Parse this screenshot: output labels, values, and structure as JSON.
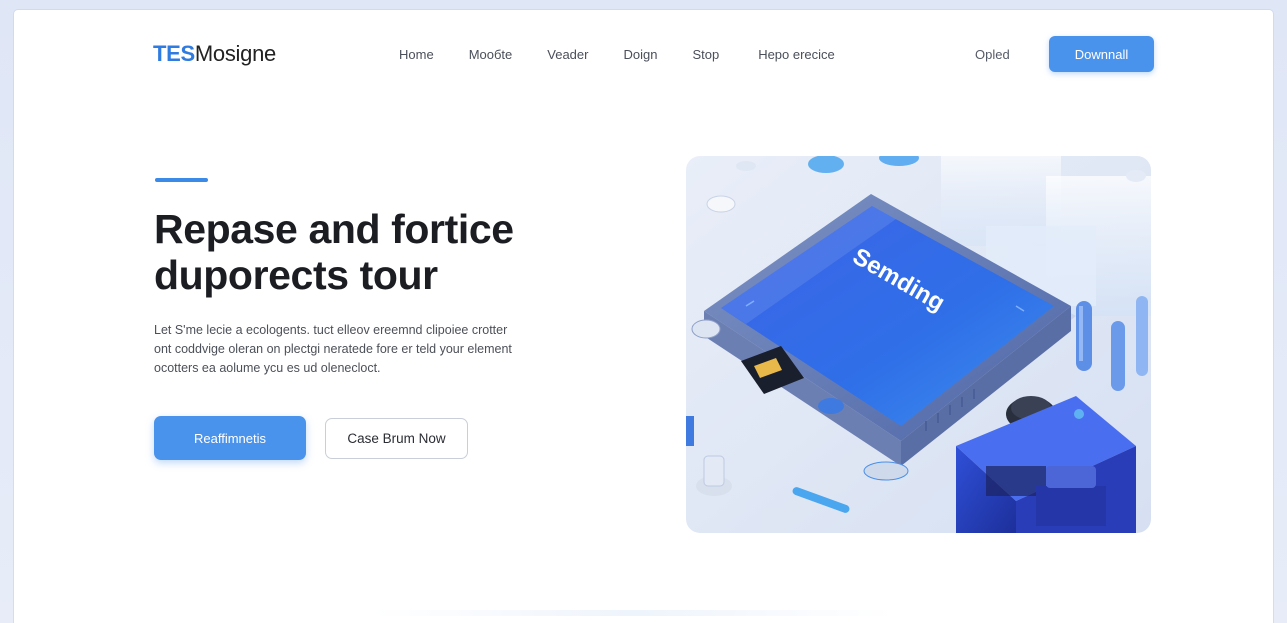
{
  "brand": {
    "prefix": "TES",
    "suffix": "Mosigne"
  },
  "nav": {
    "items": [
      "Home",
      "Moобte",
      "Veader",
      "Doign",
      "Stop",
      "Hepo erecice"
    ],
    "secondary_link": "Opled",
    "cta": "Downnall"
  },
  "hero": {
    "headline_line1": "Repase and fortice",
    "headline_line2": "duporects tour",
    "description_line1": "Let S'me lecie a ecologents. tuct elleov ereemnd clipoiee crotter",
    "description_line2": "ont coddvige oleran on plectgi neratede fore er teld your element",
    "description_line3": "ocotters ea aolume ycu es ud olenecloct.",
    "primary_button": "Reaffimnetis",
    "secondary_button": "Case Brum Now",
    "image_screen_text": "Semding"
  },
  "colors": {
    "accent": "#4a93ec",
    "brand_accent": "#2f7be0",
    "heading": "#1b1d22"
  }
}
